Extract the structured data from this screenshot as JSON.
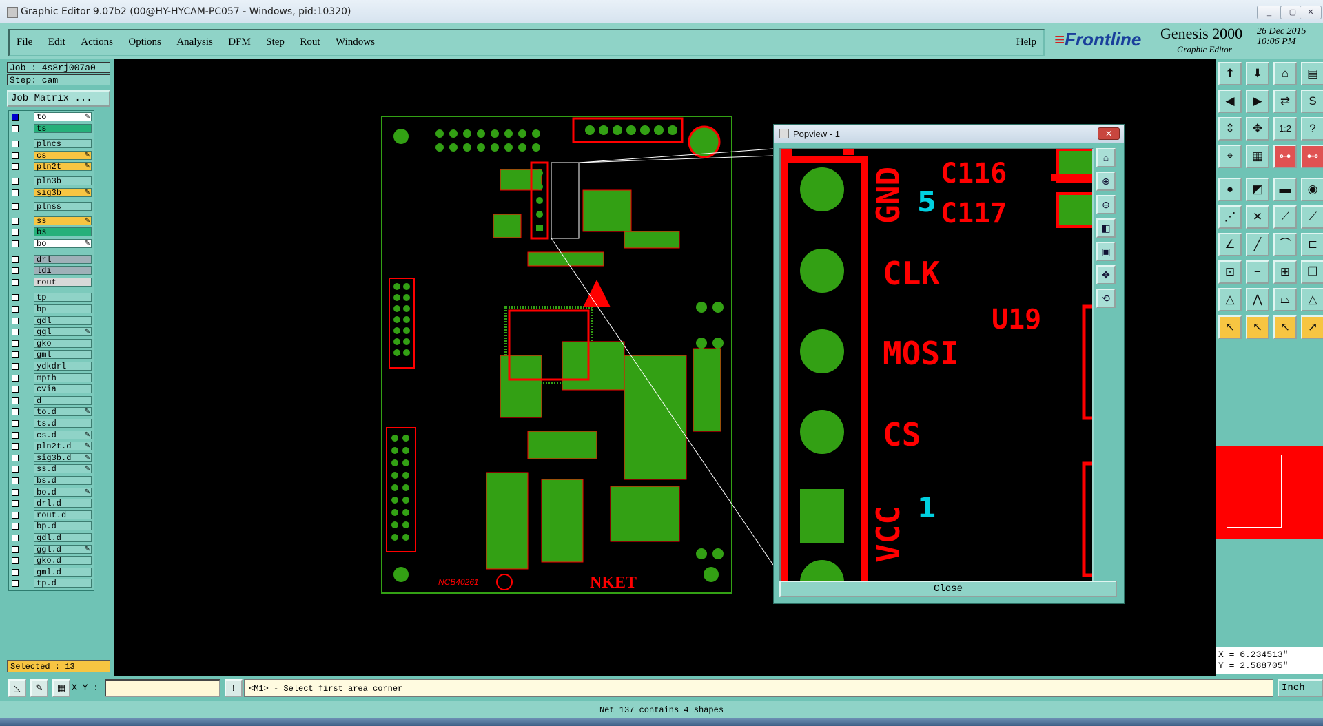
{
  "window": {
    "title": "Graphic Editor 9.07b2 (00@HY-HYCAM-PC057 - Windows, pid:10320)"
  },
  "menu": {
    "items": [
      "File",
      "Edit",
      "Actions",
      "Options",
      "Analysis",
      "DFM",
      "Step",
      "Rout",
      "Windows"
    ],
    "help": "Help"
  },
  "brand": {
    "logo": "Frontline",
    "product": "Genesis 2000",
    "subtitle": "Graphic Editor",
    "date": "26 Dec 2015",
    "time": "10:06 PM"
  },
  "job": {
    "job_label": "Job : 4s8rj007a0",
    "step_label": "Step: cam",
    "matrix_button": "Job Matrix ..."
  },
  "layers": [
    {
      "name": "to",
      "color": "#ffffff",
      "checked": true,
      "edit": true
    },
    {
      "name": "ts",
      "color": "#26b07a",
      "checked": false,
      "edit": false
    },
    {
      "name": "plncs",
      "color": "#8fd3c7",
      "checked": false,
      "edit": false
    },
    {
      "name": "cs",
      "color": "#f7c542",
      "checked": false,
      "edit": true
    },
    {
      "name": "pln2t",
      "color": "#f7c542",
      "checked": false,
      "edit": true
    },
    {
      "name": "pln3b",
      "color": "#8fd3c7",
      "checked": false,
      "edit": false
    },
    {
      "name": "sig3b",
      "color": "#f7c542",
      "checked": false,
      "edit": true
    },
    {
      "name": "plnss",
      "color": "#8fd3c7",
      "checked": false,
      "edit": false
    },
    {
      "name": "ss",
      "color": "#f7c542",
      "checked": false,
      "edit": true
    },
    {
      "name": "bs",
      "color": "#26b07a",
      "checked": false,
      "edit": false
    },
    {
      "name": "bo",
      "color": "#ffffff",
      "checked": false,
      "edit": true
    },
    {
      "name": "drl",
      "color": "#9fb0b8",
      "checked": false,
      "edit": false
    },
    {
      "name": "ldi",
      "color": "#9fb0b8",
      "checked": false,
      "edit": false
    },
    {
      "name": "rout",
      "color": "#d8d8d8",
      "checked": false,
      "edit": false
    },
    {
      "name": "tp",
      "color": "#8fd3c7",
      "checked": false,
      "edit": false
    },
    {
      "name": "bp",
      "color": "#8fd3c7",
      "checked": false,
      "edit": false
    },
    {
      "name": "gdl",
      "color": "#8fd3c7",
      "checked": false,
      "edit": false
    },
    {
      "name": "ggl",
      "color": "#8fd3c7",
      "checked": false,
      "edit": true
    },
    {
      "name": "gko",
      "color": "#8fd3c7",
      "checked": false,
      "edit": false
    },
    {
      "name": "gml",
      "color": "#8fd3c7",
      "checked": false,
      "edit": false
    },
    {
      "name": "ydkdrl",
      "color": "#8fd3c7",
      "checked": false,
      "edit": false
    },
    {
      "name": "mpth",
      "color": "#8fd3c7",
      "checked": false,
      "edit": false
    },
    {
      "name": "cvia",
      "color": "#8fd3c7",
      "checked": false,
      "edit": false
    },
    {
      "name": "d",
      "color": "#8fd3c7",
      "checked": false,
      "edit": false
    },
    {
      "name": "to.d",
      "color": "#8fd3c7",
      "checked": false,
      "edit": true
    },
    {
      "name": "ts.d",
      "color": "#8fd3c7",
      "checked": false,
      "edit": false
    },
    {
      "name": "cs.d",
      "color": "#8fd3c7",
      "checked": false,
      "edit": true
    },
    {
      "name": "pln2t.d",
      "color": "#8fd3c7",
      "checked": false,
      "edit": true
    },
    {
      "name": "sig3b.d",
      "color": "#8fd3c7",
      "checked": false,
      "edit": true
    },
    {
      "name": "ss.d",
      "color": "#8fd3c7",
      "checked": false,
      "edit": true
    },
    {
      "name": "bs.d",
      "color": "#8fd3c7",
      "checked": false,
      "edit": false
    },
    {
      "name": "bo.d",
      "color": "#8fd3c7",
      "checked": false,
      "edit": true
    },
    {
      "name": "drl.d",
      "color": "#8fd3c7",
      "checked": false,
      "edit": false
    },
    {
      "name": "rout.d",
      "color": "#8fd3c7",
      "checked": false,
      "edit": false
    },
    {
      "name": "bp.d",
      "color": "#8fd3c7",
      "checked": false,
      "edit": false
    },
    {
      "name": "gdl.d",
      "color": "#8fd3c7",
      "checked": false,
      "edit": false
    },
    {
      "name": "ggl.d",
      "color": "#8fd3c7",
      "checked": false,
      "edit": true
    },
    {
      "name": "gko.d",
      "color": "#8fd3c7",
      "checked": false,
      "edit": false
    },
    {
      "name": "gml.d",
      "color": "#8fd3c7",
      "checked": false,
      "edit": false
    },
    {
      "name": "tp.d",
      "color": "#8fd3c7",
      "checked": false,
      "edit": false
    }
  ],
  "selected_label": "Selected : 13",
  "board": {
    "footer_code": "NCB40261",
    "brand_mark": "NKET"
  },
  "popview": {
    "title": "Popview - 1",
    "pin_labels": [
      "GND",
      "CLK",
      "MOSI",
      "CS",
      "VCC"
    ],
    "component_labels": [
      "C116",
      "C117",
      "U19"
    ],
    "markers": [
      "5",
      "1"
    ],
    "close_label": "Close"
  },
  "coords": {
    "x": "X = 6.234513\"",
    "y": "Y = 2.588705\""
  },
  "bottom": {
    "xy_label": "X Y :",
    "xy_value": "",
    "prompt": "<M1> - Select first area corner",
    "unit": "Inch"
  },
  "status": "Net 137 contains 4 shapes",
  "colors": {
    "panel": "#6fc3b5",
    "copper": "#ff0000",
    "pad": "#33a014",
    "highlight": "#00d0e0"
  }
}
